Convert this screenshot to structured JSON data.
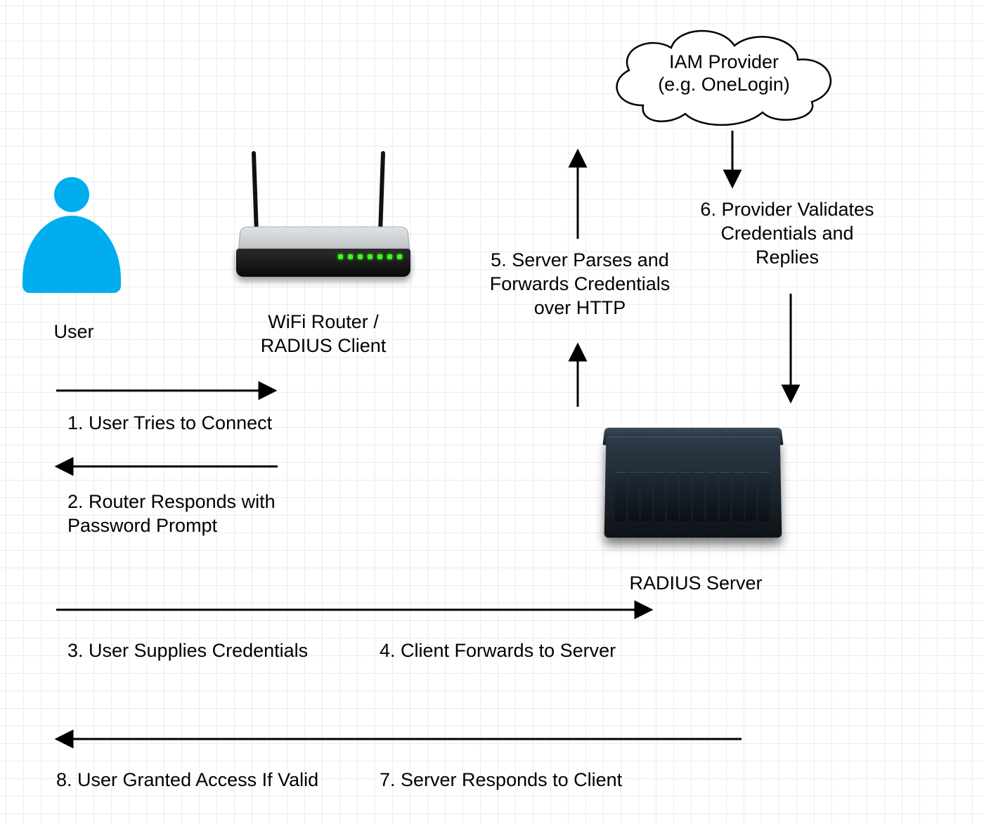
{
  "nodes": {
    "user": {
      "label": "User"
    },
    "router": {
      "label": "WiFi Router /\nRADIUS Client"
    },
    "iam": {
      "label": "IAM Provider\n(e.g. OneLogin)"
    },
    "server": {
      "label": "RADIUS Server"
    }
  },
  "steps": {
    "s1": "1. User Tries to Connect",
    "s2": "2. Router Responds with\nPassword Prompt",
    "s3": "3. User Supplies Credentials",
    "s4": "4. Client Forwards to Server",
    "s5": "5. Server Parses and\nForwards Credentials\nover HTTP",
    "s6": "6. Provider Validates\nCredentials and\nReplies",
    "s7": "7. Server Responds to Client",
    "s8": "8. User Granted Access If Valid"
  }
}
